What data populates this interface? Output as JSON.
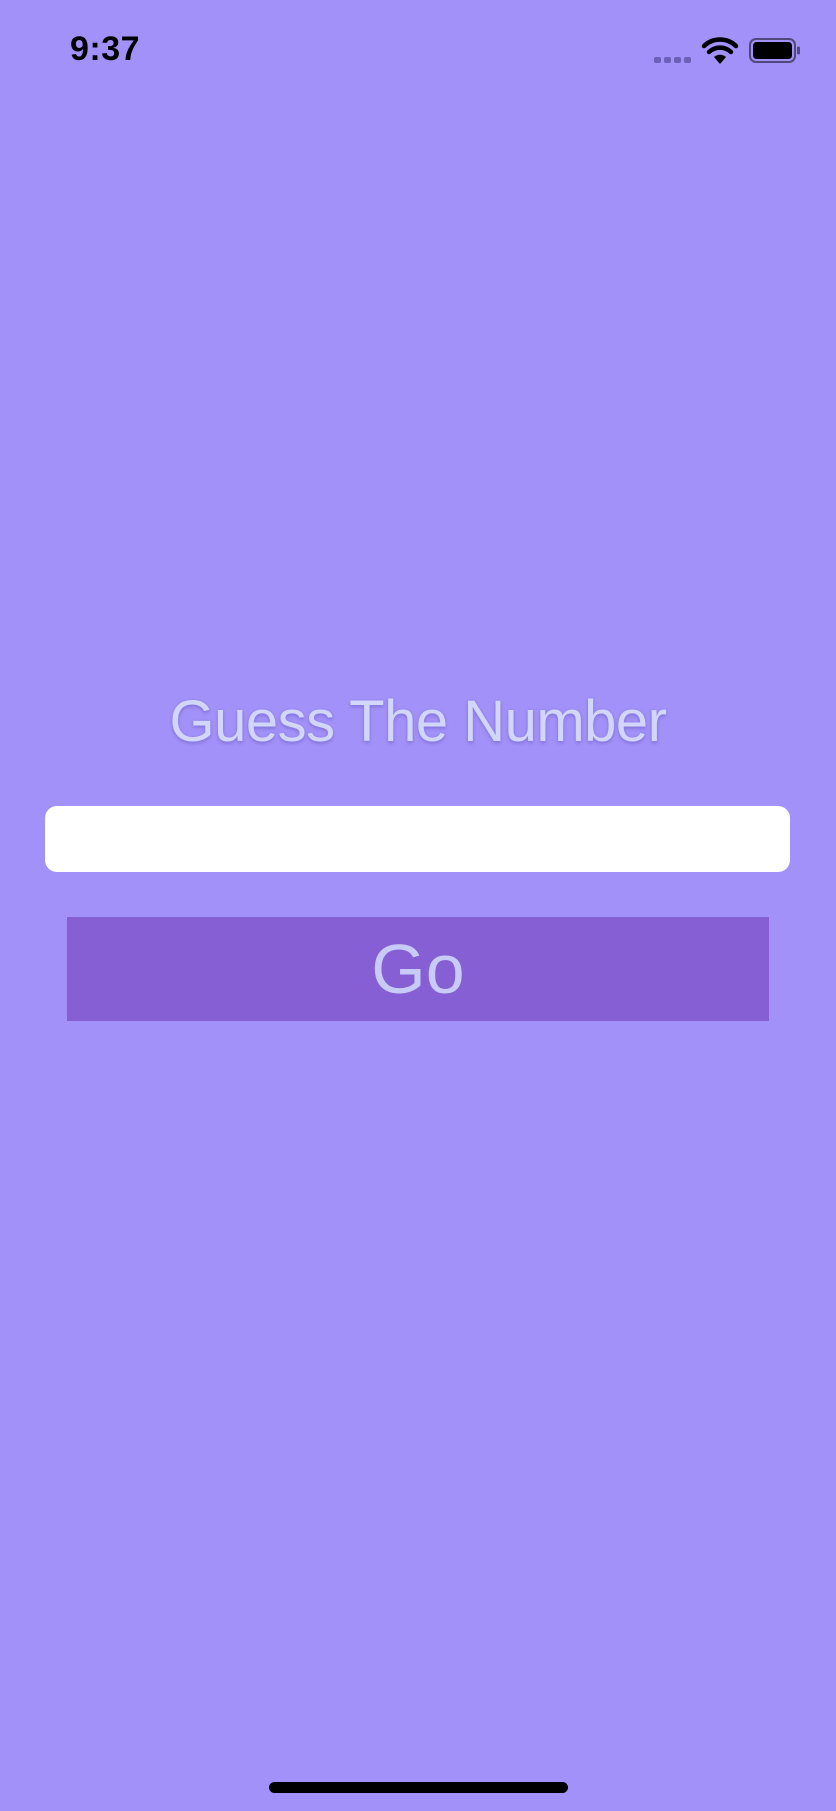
{
  "status_bar": {
    "time": "9:37",
    "signal_icon": "cellular-signal-icon",
    "wifi_icon": "wifi-icon",
    "battery_icon": "battery-icon"
  },
  "main": {
    "title": "Guess The Number",
    "guess_input": {
      "value": "",
      "placeholder": ""
    },
    "go_label": "Go"
  },
  "colors": {
    "background": "#a291f8",
    "button": "#865fd5",
    "title_text": "#d3d6fb",
    "button_text": "#c8cbf7",
    "input_background": "#ffffff"
  }
}
